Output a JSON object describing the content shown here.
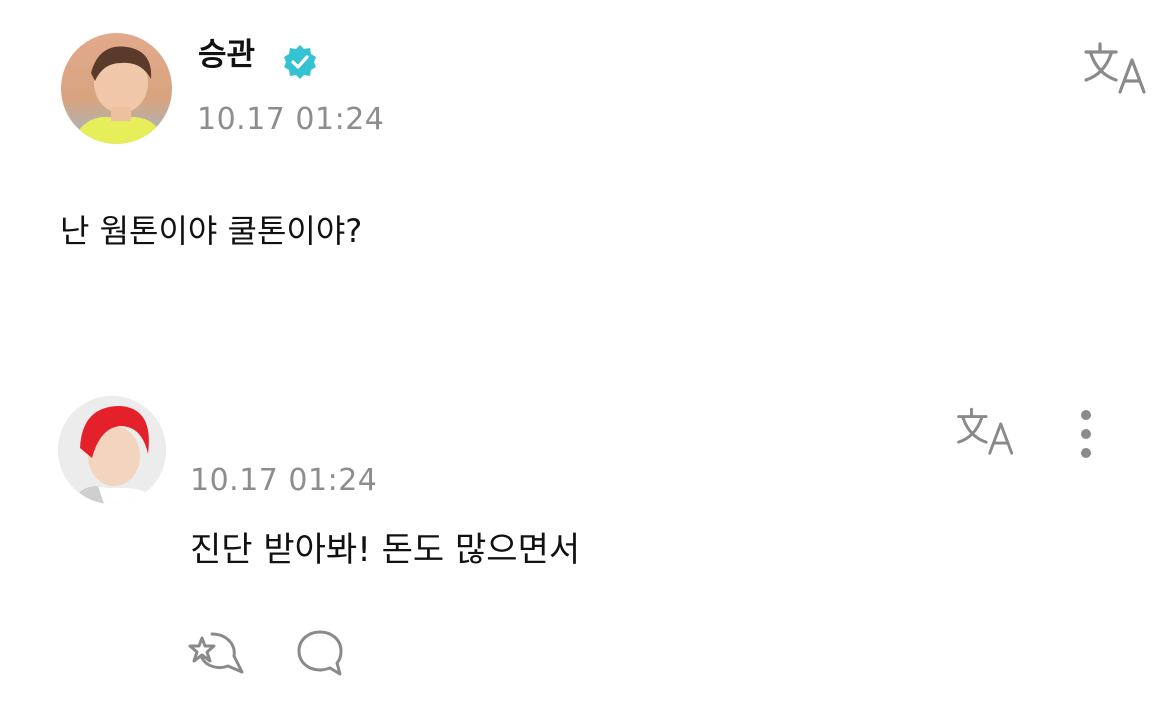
{
  "post": {
    "author": "승관",
    "timestamp": "10.17 01:24",
    "text": "난 웜톤이야 쿨톤이야?",
    "verified": true,
    "icons": [
      "verified-badge-icon",
      "translate-icon"
    ]
  },
  "comment": {
    "timestamp": "10.17 01:24",
    "text": "진단 받아봐! 돈도 많으면서",
    "icons": [
      "translate-icon",
      "more-vertical-icon",
      "like-icon",
      "reply-icon"
    ]
  },
  "colors": {
    "accent_verified": "#35c3d3",
    "timestamp": "#8d8d8d",
    "text": "#111111",
    "icon": "#8a8a8a"
  }
}
